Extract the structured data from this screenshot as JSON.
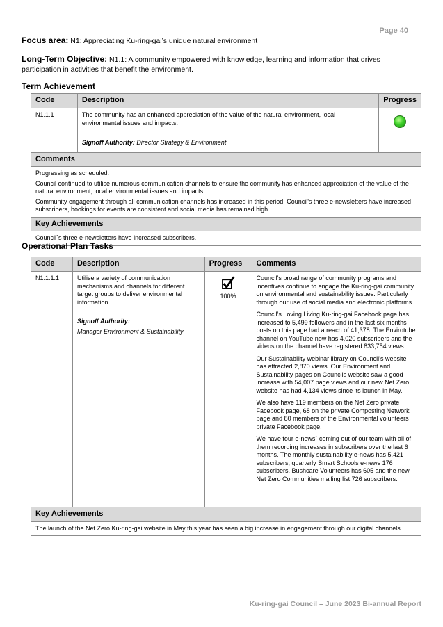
{
  "page_number": "Page 40",
  "focus_area": {
    "label": "Focus area:",
    "value": "N1: Appreciating Ku-ring-gai’s unique natural environment"
  },
  "objective": {
    "label": "Long-Term Objective:",
    "value": "N1.1: A community empowered with knowledge, learning and information that drives participation in activities that benefit the environment."
  },
  "term_achievement": {
    "title": "Term Achievement",
    "headers": {
      "code": "Code",
      "description": "Description",
      "progress": "Progress"
    },
    "code": "N1.1.1",
    "description": "The community has an enhanced appreciation of the value of the natural environment, local environmental issues and impacts.",
    "signoff_label": "Signoff Authority:",
    "signoff_value": "Director Strategy & Environment",
    "progress_status": "green",
    "comments_label": "Comments",
    "comments": [
      "Progressing as scheduled.",
      "Council continued to utilise numerous communication channels to ensure the community has enhanced appreciation of the value of the natural environment, local environmental issues and impacts.",
      "Community engagement through all communication channels has increased in this period. Council's three e-newsletters have increased subscribers, bookings for events are consistent and social media has remained high."
    ],
    "key_label": "Key Achievements",
    "key_text": "Council`s three e-newsletters have increased subscribers."
  },
  "operational": {
    "title": "Operational Plan Tasks",
    "headers": {
      "code": "Code",
      "description": "Description",
      "progress": "Progress",
      "comments": "Comments"
    },
    "code": "N1.1.1.1",
    "description": "Utilise a variety of communication mechanisms and channels for different target groups to deliver environmental information.",
    "signoff_label": "Signoff Authority:",
    "signoff_value": "Manager Environment & Sustainability",
    "progress": "100%",
    "comments": [
      "Council’s broad range of community programs and incentives continue to engage the Ku-ring-gai community on environmental and sustainability issues. Particularly through our use of social media and electronic platforms.",
      "Council’s Loving Living Ku-ring-gai Facebook page has increased to 5,499 followers and in the last six months posts on this page had a reach of 41,378. The Envirotube channel on YouTube now has 4,020 subscribers and the videos on the channel have registered 833,754 views.",
      "Our Sustainability webinar library on Council’s website has attracted 2,870 views. Our Environment and Sustainability pages on Councils website saw a good increase with 54,007 page views and our new Net Zero website has had 4,134 views since its launch in May.",
      "We also have 119 members on the Net Zero private Facebook page, 68 on the private Composting Network page and 80 members of the Environmental volunteers private Facebook page.",
      "We have four e-news` coming out of our team with all of them recording increases in subscribers over the last 6 months. The monthly sustainability e-news has 5,421 subscribers, quarterly Smart Schools e-news 176 subscribers, Bushcare Volunteers has 605 and the new Net Zero Communities mailing list 726 subscribers."
    ],
    "key_label": "Key Achievements",
    "key_text": "The launch of the Net Zero Ku-ring-gai website in May this year has seen a big increase in engagement through our digital channels."
  },
  "footer": "Ku-ring-gai Council – June 2023 Bi-annual Report"
}
